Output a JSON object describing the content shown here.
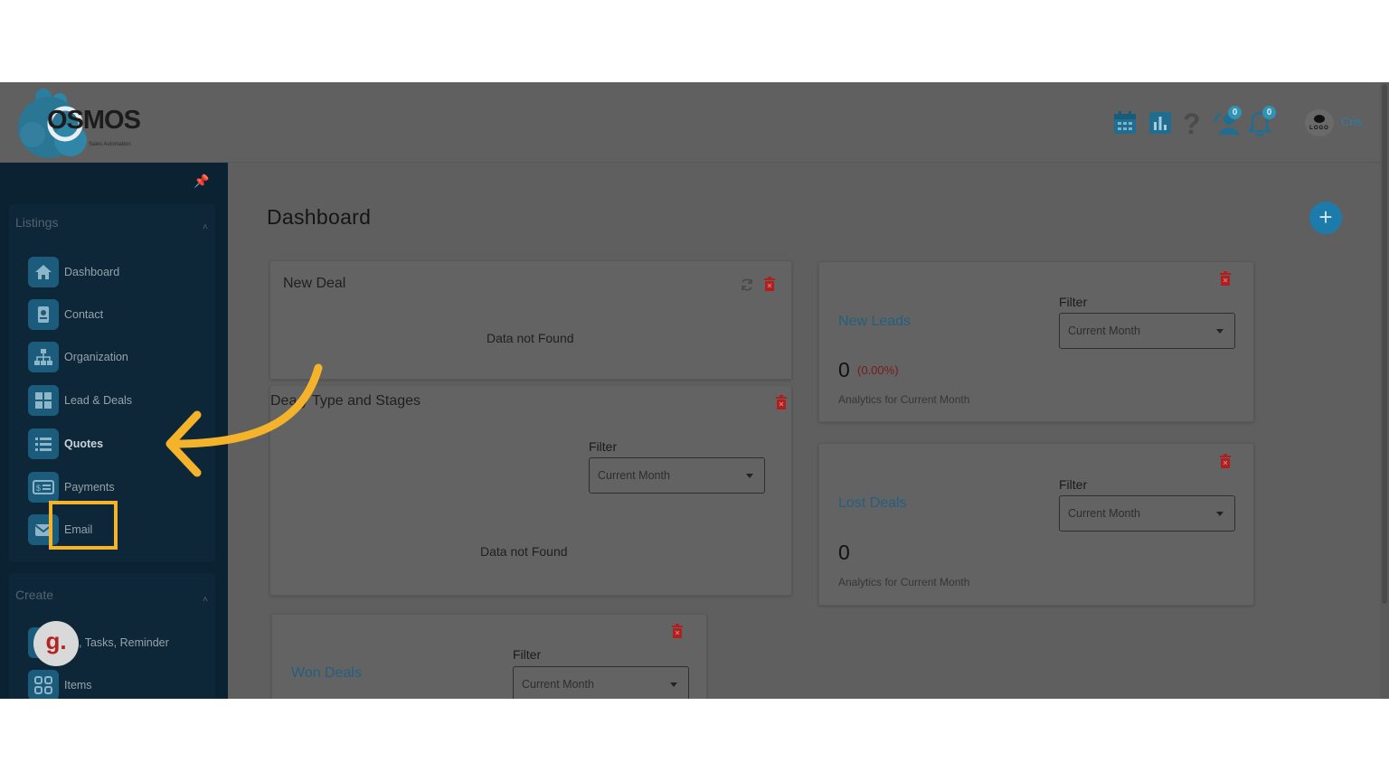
{
  "app": {
    "logo_text": "OSMOS",
    "logo_tagline": "Sales Automation"
  },
  "header": {
    "user_name": "Cris",
    "user_logo_text": "LOGO",
    "user_badge": "0",
    "bell_badge": "0",
    "icons": [
      "calendar-icon",
      "report-icon",
      "help-icon",
      "user-notification-icon",
      "bell-icon"
    ]
  },
  "sidebar": {
    "listings_title": "Listings",
    "create_title": "Create",
    "items": [
      {
        "label": "Dashboard",
        "icon": "home-icon"
      },
      {
        "label": "Contact",
        "icon": "contact-card-icon"
      },
      {
        "label": "Organization",
        "icon": "org-chart-icon"
      },
      {
        "label": "Lead & Deals",
        "icon": "grid-icon"
      },
      {
        "label": "Quotes",
        "icon": "list-icon"
      },
      {
        "label": "Payments",
        "icon": "payment-icon"
      },
      {
        "label": "Email",
        "icon": "mail-icon"
      }
    ],
    "create_items": [
      {
        "label": "als, Tasks, Reminder",
        "icon": "task-icon"
      },
      {
        "label": "Items",
        "icon": "items-grid-icon"
      }
    ],
    "avatar_letter": "g."
  },
  "main": {
    "title": "Dashboard",
    "add_label": "+",
    "new_deal": {
      "title": "New Deal",
      "empty": "Data not Found"
    },
    "deals_by_type": {
      "title": "Dea    y Type and Stages",
      "filter_label": "Filter",
      "filter_value": "Current Month",
      "empty": "Data not Found"
    },
    "won_deals": {
      "label": "Won Deals",
      "filter_label": "Filter",
      "filter_value": "Current Month"
    },
    "new_leads": {
      "label": "New Leads",
      "filter_label": "Filter",
      "filter_value": "Current Month",
      "value": "0",
      "pct": "(0.00%)",
      "note": "Analytics for Current Month"
    },
    "lost_deals": {
      "label": "Lost Deals",
      "filter_label": "Filter",
      "filter_value": "Current Month",
      "value": "0",
      "note": "Analytics for Current Month"
    }
  },
  "colors": {
    "accent": "#1d7bab",
    "sidebar_bg": "#0b2233",
    "highlight": "#f4b32b",
    "danger": "#b01e1e"
  }
}
